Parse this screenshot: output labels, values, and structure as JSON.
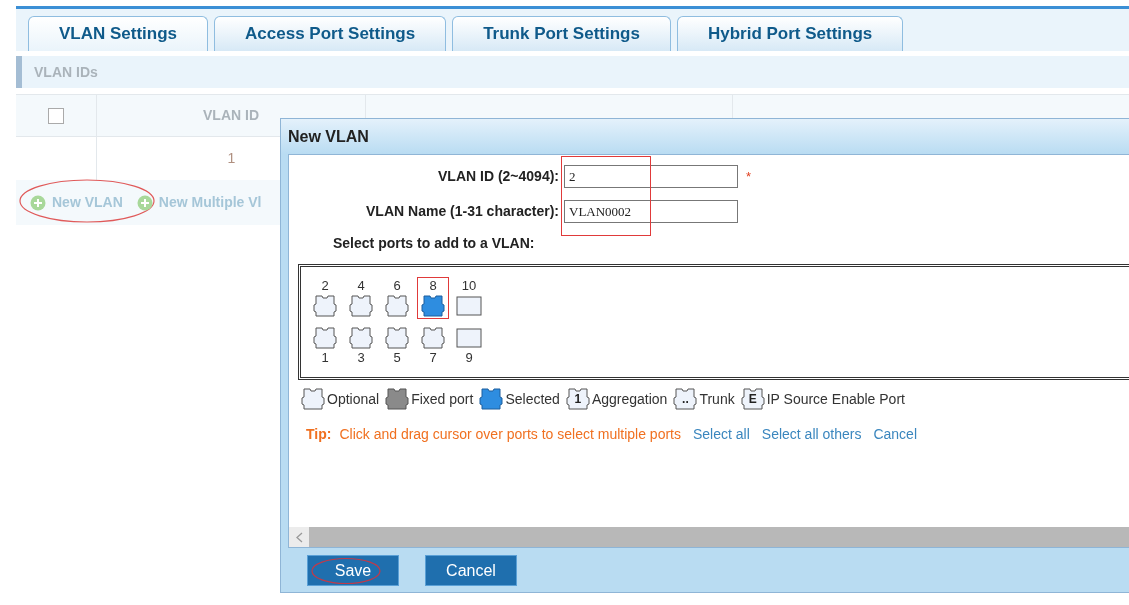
{
  "tabs": [
    {
      "label": "VLAN Settings",
      "selected": true
    },
    {
      "label": "Access Port Settings",
      "selected": false
    },
    {
      "label": "Trunk Port Settings",
      "selected": false
    },
    {
      "label": "Hybrid Port Settings",
      "selected": false
    }
  ],
  "section_title": "VLAN IDs",
  "table": {
    "select_all_checked": false,
    "columns": [
      "VLAN ID"
    ],
    "rows": [
      {
        "vlan_id": "1"
      }
    ]
  },
  "actions": [
    {
      "label": "New VLAN",
      "annotated": true
    },
    {
      "label": "New Multiple Vl",
      "annotated": false
    }
  ],
  "dialog": {
    "title": "New VLAN",
    "fields": [
      {
        "label": "VLAN ID (2~4094):",
        "value": "2",
        "required": "*"
      },
      {
        "label": "VLAN Name (1-31 character):",
        "value": "VLAN0002"
      }
    ],
    "ports_label": "Select ports to add to a VLAN:",
    "port_rows": [
      {
        "ports": [
          {
            "label": "2",
            "kind": "rj45",
            "selected": false,
            "highlighted": false
          },
          {
            "label": "4",
            "kind": "rj45",
            "selected": false,
            "highlighted": false
          },
          {
            "label": "6",
            "kind": "rj45",
            "selected": false,
            "highlighted": false
          },
          {
            "label": "8",
            "kind": "rj45",
            "selected": true,
            "highlighted": true
          },
          {
            "label": "10",
            "kind": "sfp",
            "selected": false,
            "highlighted": false
          }
        ]
      },
      {
        "ports": [
          {
            "label": "1",
            "kind": "rj45",
            "selected": false,
            "highlighted": false
          },
          {
            "label": "3",
            "kind": "rj45",
            "selected": false,
            "highlighted": false
          },
          {
            "label": "5",
            "kind": "rj45",
            "selected": false,
            "highlighted": false
          },
          {
            "label": "7",
            "kind": "rj45",
            "selected": false,
            "highlighted": false
          },
          {
            "label": "9",
            "kind": "sfp",
            "selected": false,
            "highlighted": false
          }
        ]
      }
    ],
    "legend": [
      {
        "kind": "optional",
        "label": "Optional"
      },
      {
        "kind": "fixed",
        "label": "Fixed port"
      },
      {
        "kind": "selected",
        "label": "Selected"
      },
      {
        "kind": "aggregation",
        "glyph": "1",
        "label": "Aggregation"
      },
      {
        "kind": "trunk",
        "glyph": "..",
        "label": "Trunk"
      },
      {
        "kind": "ip_source",
        "glyph": "E",
        "label": "IP Source Enable Port"
      }
    ],
    "tip_label": "Tip:",
    "tip": "Click and drag cursor over ports to select multiple ports",
    "links": [
      "Select all",
      "Select all others",
      "Cancel"
    ],
    "buttons": [
      {
        "label": "Save",
        "annotated": true
      },
      {
        "label": "Cancel",
        "annotated": false
      }
    ]
  }
}
